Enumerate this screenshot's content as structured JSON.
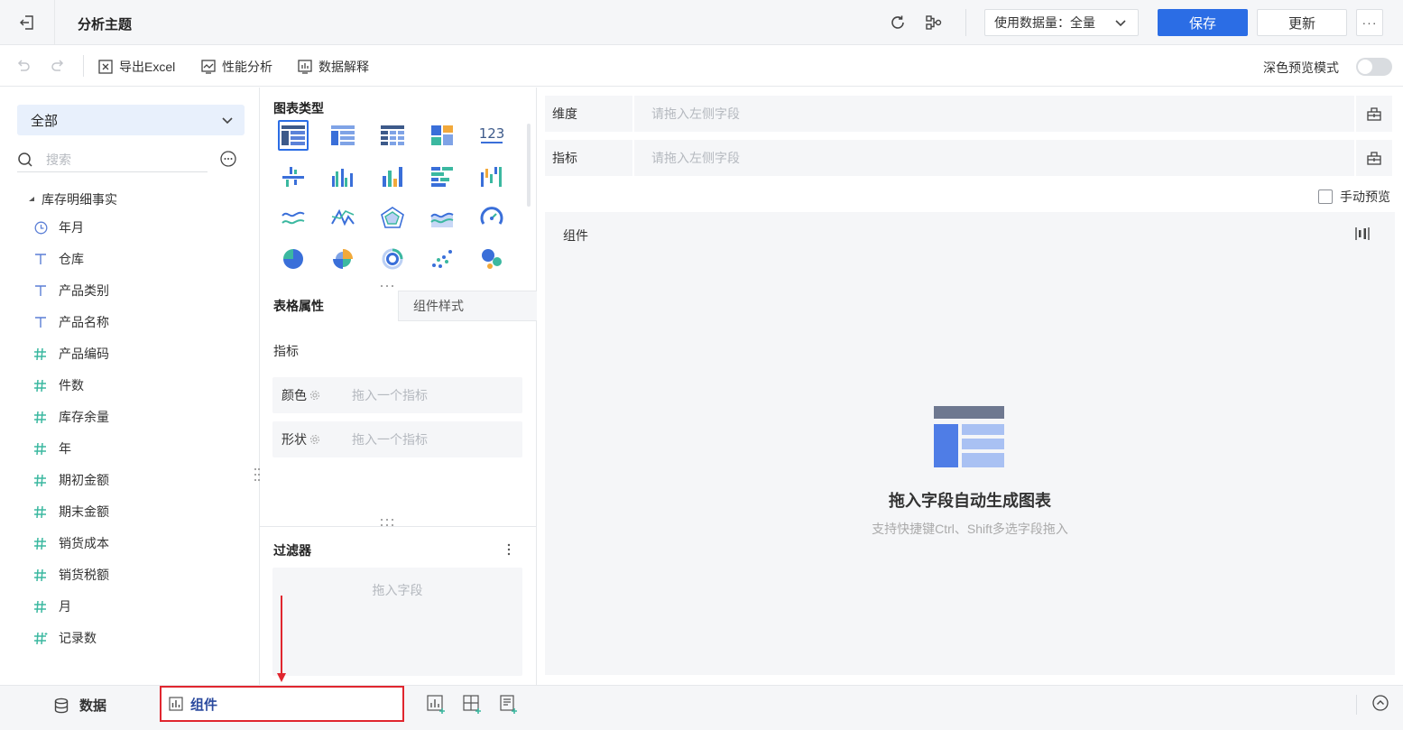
{
  "topbar": {
    "title": "分析主题",
    "data_volume_label": "使用数据量：全量",
    "save_label": "保存",
    "update_label": "更新",
    "more_label": "···"
  },
  "toolbar": {
    "export_label": "导出Excel",
    "perf_label": "性能分析",
    "explain_label": "数据解释",
    "dark_mode_label": "深色预览模式",
    "dark_mode_on": false
  },
  "left": {
    "category": "全部",
    "search_placeholder": "搜索",
    "table_name": "库存明细事实",
    "fields": [
      {
        "label": "年月",
        "type": "date"
      },
      {
        "label": "仓库",
        "type": "text"
      },
      {
        "label": "产品类别",
        "type": "text"
      },
      {
        "label": "产品名称",
        "type": "text"
      },
      {
        "label": "产品编码",
        "type": "number"
      },
      {
        "label": "件数",
        "type": "number"
      },
      {
        "label": "库存余量",
        "type": "number"
      },
      {
        "label": "年",
        "type": "number"
      },
      {
        "label": "期初金额",
        "type": "number"
      },
      {
        "label": "期末金额",
        "type": "number"
      },
      {
        "label": "销货成本",
        "type": "number"
      },
      {
        "label": "销货税额",
        "type": "number"
      },
      {
        "label": "月",
        "type": "number"
      },
      {
        "label": "记录数",
        "type": "count"
      }
    ]
  },
  "middle": {
    "chart_type_title": "图表类型",
    "tab_table": "表格属性",
    "tab_style": "组件样式",
    "metric_label": "指标",
    "color_label": "颜色",
    "color_placeholder": "拖入一个指标",
    "shape_label": "形状",
    "shape_placeholder": "拖入一个指标",
    "filter_title": "过滤器",
    "filter_placeholder": "拖入字段"
  },
  "right": {
    "dimension_label": "维度",
    "dimension_placeholder": "请拖入左侧字段",
    "metric_label": "指标",
    "metric_placeholder": "请拖入左侧字段",
    "manual_preview_label": "手动预览",
    "canvas_title": "组件",
    "empty_title": "拖入字段自动生成图表",
    "empty_subtitle": "支持快捷键Ctrl、Shift多选字段拖入"
  },
  "bottom": {
    "data_tab": "数据",
    "component_tab": "组件"
  },
  "colors": {
    "accent": "#2b6de5",
    "annotation": "#e0262f",
    "number_field": "#3bb8a0"
  }
}
